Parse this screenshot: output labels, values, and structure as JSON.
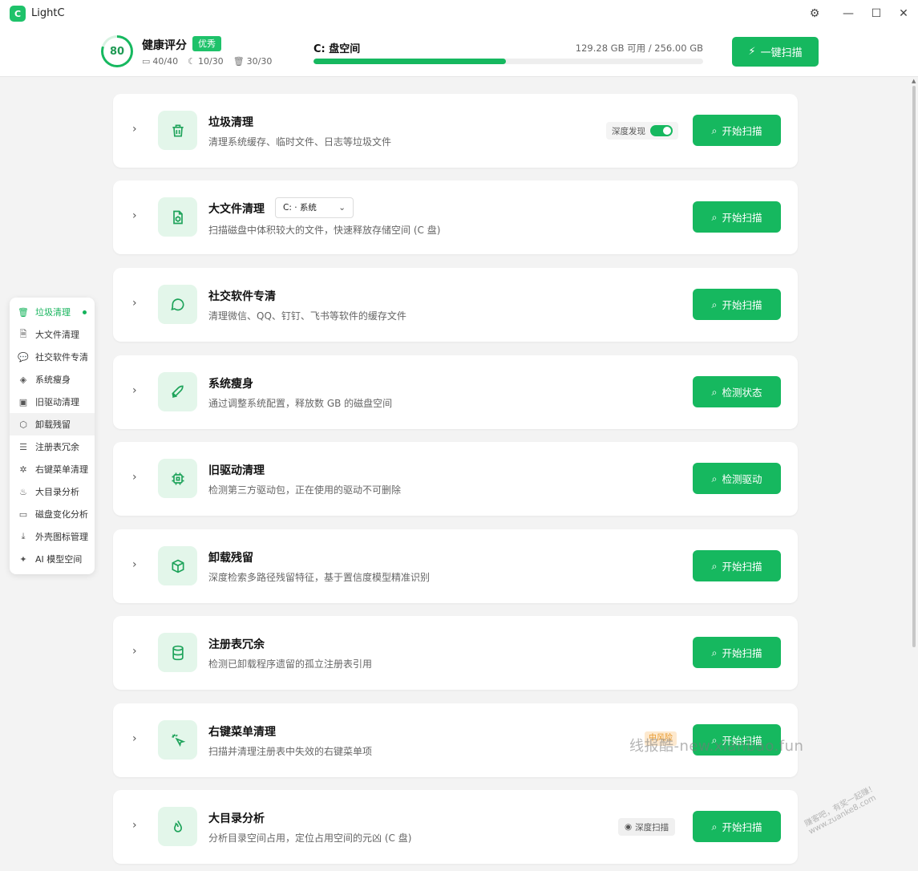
{
  "app": {
    "logo_text": "C",
    "name": "LightC"
  },
  "window_controls": {
    "settings_icon": "⚙",
    "minimize_icon": "—",
    "maximize_icon": "☐",
    "close_icon": "✕"
  },
  "health": {
    "score": "80",
    "score_fraction": 0.8,
    "title": "健康评分",
    "badge": "优秀",
    "stats": [
      {
        "icon": "drive-icon",
        "glyph": "▭",
        "value": "40/40"
      },
      {
        "icon": "moon-icon",
        "glyph": "☾",
        "value": "10/30"
      },
      {
        "icon": "trash-icon",
        "glyph": "🗑",
        "value": "30/30"
      }
    ]
  },
  "disk": {
    "title": "C: 盘空间",
    "available": "129.28 GB 可用 / 256.00 GB",
    "used_fraction": 0.494
  },
  "oneclick": {
    "icon": "⚡",
    "label": "一键扫描"
  },
  "colors": {
    "accent": "#16b85f",
    "accent_light": "#e3f6ea",
    "badge_risk": "#e79a2e"
  },
  "sidenav": {
    "items": [
      {
        "name": "trash-icon",
        "glyph": "🗑",
        "label": "垃圾清理"
      },
      {
        "name": "file-icon",
        "glyph": "🗎",
        "label": "大文件清理"
      },
      {
        "name": "chat-icon",
        "glyph": "💬",
        "label": "社交软件专清"
      },
      {
        "name": "layers-icon",
        "glyph": "◈",
        "label": "系统瘦身"
      },
      {
        "name": "chip-icon",
        "glyph": "▣",
        "label": "旧驱动清理"
      },
      {
        "name": "box-icon",
        "glyph": "⬡",
        "label": "卸载残留"
      },
      {
        "name": "database-icon",
        "glyph": "☰",
        "label": "注册表冗余"
      },
      {
        "name": "cursor-icon",
        "glyph": "✲",
        "label": "右键菜单清理"
      },
      {
        "name": "flame-icon",
        "glyph": "♨",
        "label": "大目录分析"
      },
      {
        "name": "disk-icon",
        "glyph": "▭",
        "label": "磁盘变化分析"
      },
      {
        "name": "download-icon",
        "glyph": "⤓",
        "label": "外壳图标管理"
      },
      {
        "name": "ai-icon",
        "glyph": "✦",
        "label": "AI 模型空间"
      }
    ]
  },
  "cards": [
    {
      "icon": "trash-icon",
      "glyph": "🗑",
      "title": "垃圾清理",
      "desc": "清理系统缓存、临时文件、日志等垃圾文件",
      "button": "开始扫描",
      "toggle_label": "深度发现"
    },
    {
      "icon": "file-icon",
      "glyph": "🗎",
      "title": "大文件清理",
      "desc": "扫描磁盘中体积较大的文件，快速释放存储空间 (C 盘)",
      "button": "开始扫描",
      "select_value": "C: · 系统"
    },
    {
      "icon": "chat-icon",
      "glyph": "💬",
      "title": "社交软件专清",
      "desc": "清理微信、QQ、钉钉、飞书等软件的缓存文件",
      "button": "开始扫描"
    },
    {
      "icon": "rocket-icon",
      "glyph": "🚀",
      "title": "系统瘦身",
      "desc": "通过调整系统配置，释放数 GB 的磁盘空间",
      "button": "检测状态"
    },
    {
      "icon": "chip-icon",
      "glyph": "▣",
      "title": "旧驱动清理",
      "desc": "检测第三方驱动包，正在使用的驱动不可删除",
      "button": "检测驱动"
    },
    {
      "icon": "box-icon",
      "glyph": "⬡",
      "title": "卸载残留",
      "desc": "深度检索多路径残留特征，基于置信度模型精准识别",
      "button": "开始扫描"
    },
    {
      "icon": "database-icon",
      "glyph": "☰",
      "title": "注册表冗余",
      "desc": "检测已卸载程序遗留的孤立注册表引用",
      "button": "开始扫描"
    },
    {
      "icon": "cursor-icon",
      "glyph": "✲",
      "title": "右键菜单清理",
      "desc": "扫描并清理注册表中失效的右键菜单项",
      "button": "开始扫描",
      "tag": "中风险"
    },
    {
      "icon": "flame-icon",
      "glyph": "♨",
      "title": "大目录分析",
      "desc": "分析目录空间占用，定位占用空间的元凶 (C 盘)",
      "button": "开始扫描",
      "chip_label": "深度扫描"
    }
  ],
  "watermark": {
    "main": "线报酷-new.xianbao.fun",
    "corner": "赚客吧，有奖一起赚！www.zuanke8.com"
  }
}
